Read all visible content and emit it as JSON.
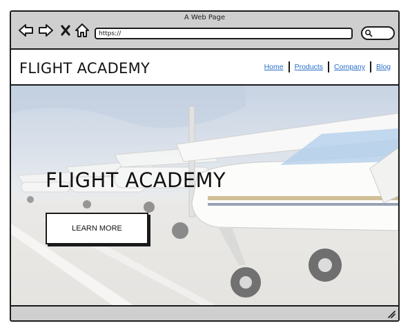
{
  "window": {
    "title": "A Web Page",
    "url_value": "https://"
  },
  "toolbar": {
    "icons": [
      "back-arrow-icon",
      "forward-arrow-icon",
      "close-x-icon",
      "home-icon",
      "search-icon"
    ]
  },
  "header": {
    "brand": "FLIGHT ACADEMY",
    "nav": [
      {
        "label": "Home"
      },
      {
        "label": "Products"
      },
      {
        "label": "Company"
      },
      {
        "label": "Blog"
      }
    ]
  },
  "hero": {
    "title": "FLIGHT ACADEMY",
    "button_label": "LEARN MORE"
  },
  "colors": {
    "chrome": "#cfcfcf",
    "link": "#2a6fc9",
    "outline": "#1a1a1a"
  }
}
